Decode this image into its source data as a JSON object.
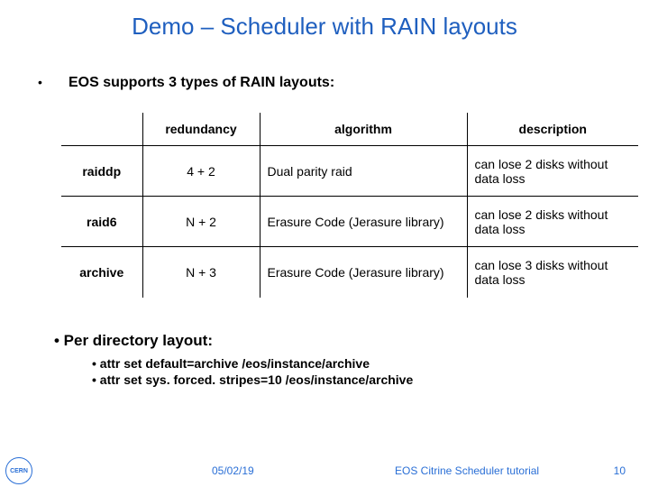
{
  "title": "Demo – Scheduler with RAIN layouts",
  "bullet": "EOS supports 3 types of RAIN layouts:",
  "table": {
    "headers": [
      "",
      "redundancy",
      "algorithm",
      "description"
    ],
    "rows": [
      {
        "name": "raiddp",
        "redundancy": "4 + 2",
        "algorithm": "Dual parity raid",
        "description": "can lose 2 disks without data loss"
      },
      {
        "name": "raid6",
        "redundancy": "N + 2",
        "algorithm": "Erasure Code (Jerasure library)",
        "description": "can lose 2 disks without data loss"
      },
      {
        "name": "archive",
        "redundancy": "N + 3",
        "algorithm": "Erasure Code (Jerasure library)",
        "description": "can lose 3 disks without data loss"
      }
    ]
  },
  "per_dir": {
    "title": "• Per directory layout:",
    "items": [
      "• attr set default=archive /eos/instance/archive",
      "• attr set sys. forced. stripes=10 /eos/instance/archive"
    ]
  },
  "footer": {
    "logo": "CERN",
    "date": "05/02/19",
    "title": "EOS Citrine Scheduler tutorial",
    "page": "10"
  }
}
